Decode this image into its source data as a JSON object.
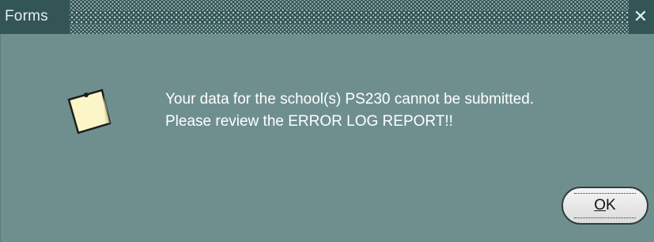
{
  "window": {
    "title": "Forms",
    "close_glyph": "✕"
  },
  "message": {
    "line1": "Your data for the school(s) PS230 cannot be submitted.",
    "line2": "Please review the ERROR LOG REPORT!!"
  },
  "icon": {
    "name": "note-icon"
  },
  "ok_button": {
    "mnemonic": "O",
    "rest": "K"
  },
  "colors": {
    "titlebar": "#335555",
    "dialog_body": "#6f8f8f",
    "message_text": "#ffffff",
    "note_fill": "#fbf5c8"
  }
}
